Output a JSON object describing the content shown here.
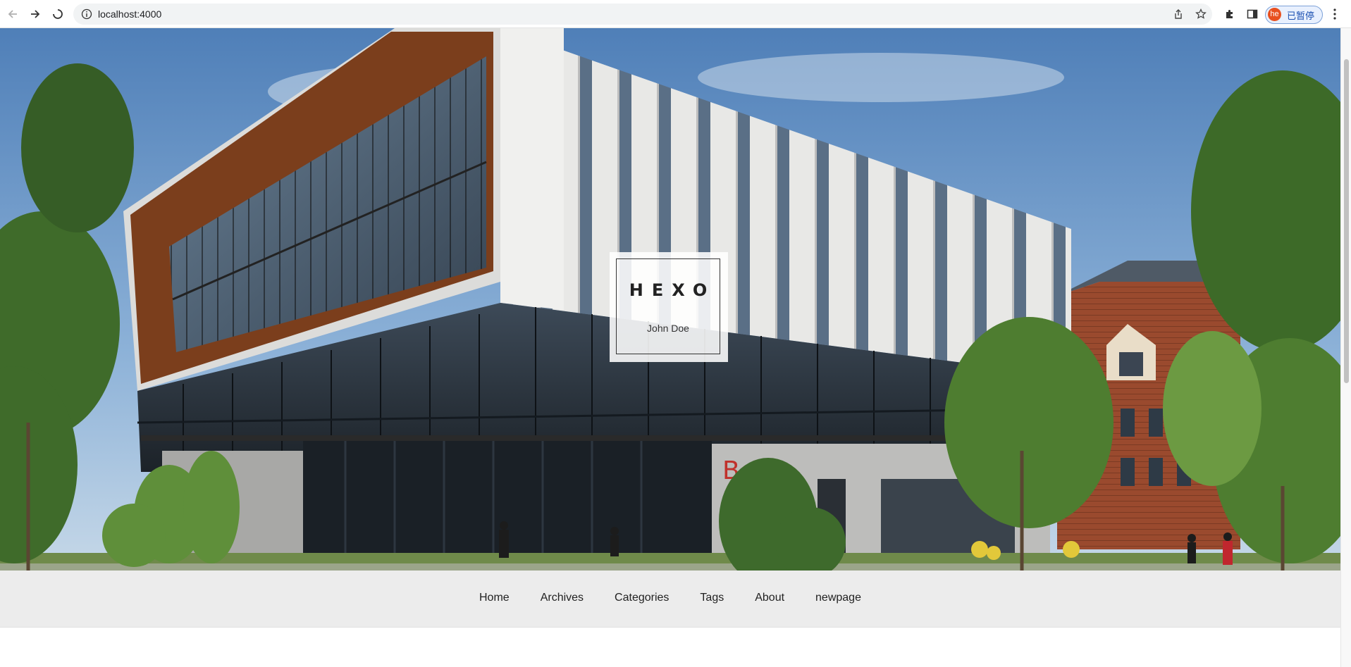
{
  "browser": {
    "url": "localhost:4000",
    "profile_initials": "he",
    "profile_status": "已暂停"
  },
  "hero": {
    "title": "HEXO",
    "subtitle": "John Doe"
  },
  "nav": {
    "items": [
      "Home",
      "Archives",
      "Categories",
      "Tags",
      "About",
      "newpage"
    ]
  }
}
